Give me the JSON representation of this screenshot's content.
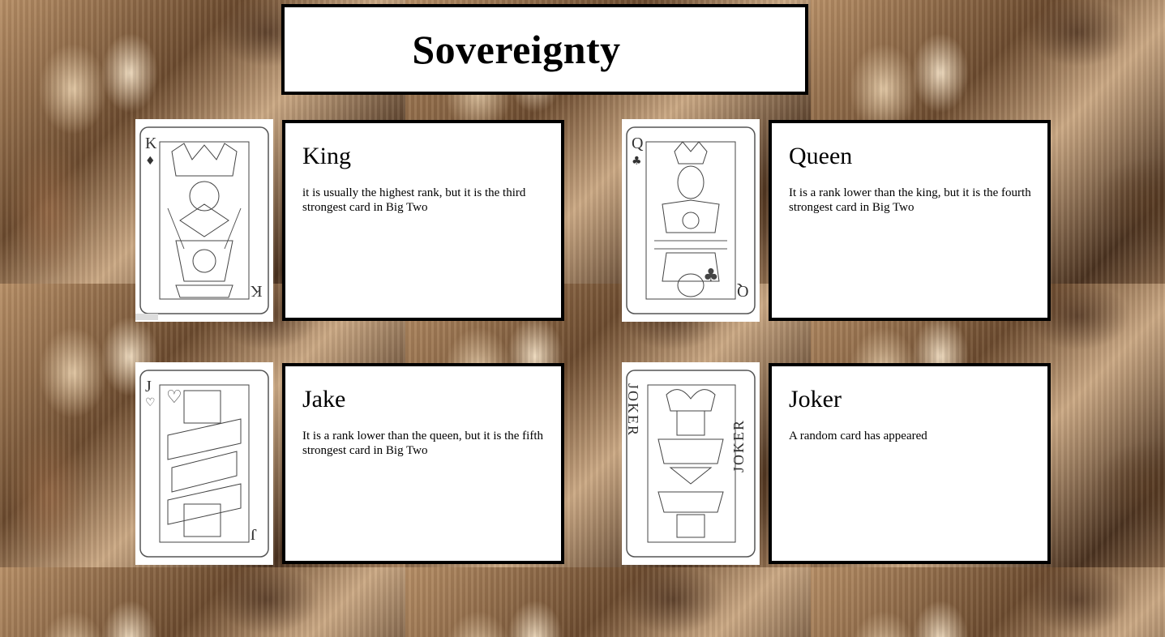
{
  "page": {
    "title": "Sovereignty"
  },
  "cards": [
    {
      "name": "King",
      "description": "it is usually the highest rank, but it is the third strongest card in Big Two",
      "corner_rank": "K",
      "suit_symbol": "♦",
      "image_icon": "king-of-diamonds-card"
    },
    {
      "name": "Queen",
      "description": "It is a rank lower than the king, but it is the fourth strongest card in Big Two",
      "corner_rank": "Q",
      "suit_symbol": "♣",
      "image_icon": "queen-of-clubs-card"
    },
    {
      "name": "Jake",
      "description": "It is a rank lower than the queen, but it is the fifth strongest card in Big Two",
      "corner_rank": "J",
      "suit_symbol": "♡",
      "image_icon": "jack-of-hearts-card"
    },
    {
      "name": "Joker",
      "description": "A random card has appeared",
      "corner_rank": "JOKER",
      "suit_symbol": "",
      "image_icon": "joker-card"
    }
  ]
}
